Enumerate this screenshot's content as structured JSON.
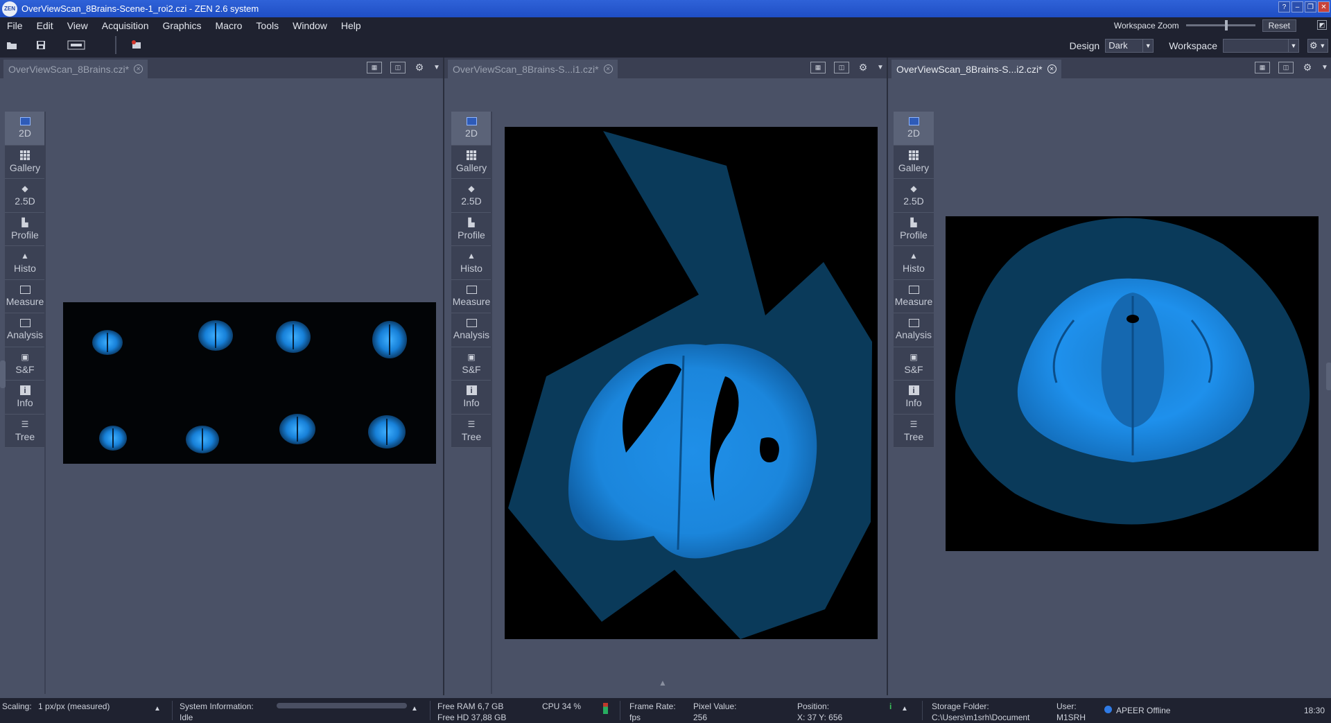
{
  "window": {
    "app_icon": "ZEN",
    "title": "OverViewScan_8Brains-Scene-1_roi2.czi - ZEN 2.6 system",
    "controls": [
      "?",
      "–",
      "❐",
      "✕"
    ]
  },
  "menu": {
    "items": [
      "File",
      "Edit",
      "View",
      "Acquisition",
      "Graphics",
      "Macro",
      "Tools",
      "Window",
      "Help"
    ],
    "workspace_zoom_label": "Workspace Zoom",
    "reset_label": "Reset"
  },
  "toolbar": {
    "design_label": "Design",
    "design_value": "Dark",
    "workspace_label": "Workspace",
    "workspace_value": ""
  },
  "viewbar": {
    "buttons": [
      "2D",
      "Gallery",
      "2.5D",
      "Profile",
      "Histo",
      "Measure",
      "Analysis",
      "S&F",
      "Info",
      "Tree"
    ]
  },
  "panes": [
    {
      "tab_title": "OverViewScan_8Brains.czi*",
      "active": false
    },
    {
      "tab_title": "OverViewScan_8Brains-S...i1.czi*",
      "active": false
    },
    {
      "tab_title": "OverViewScan_8Brains-S...i2.czi*",
      "active": true
    }
  ],
  "status": {
    "scaling_label": "Scaling:",
    "scaling_value": "1 px/px (measured)",
    "sysinfo_label": "System Information:",
    "sysinfo_value": "Idle",
    "free_ram": "Free RAM 6,7 GB",
    "free_hd": "Free HD   37,88 GB",
    "cpu": "CPU 34 %",
    "frame_rate_label": "Frame Rate:",
    "frame_rate_value": "fps",
    "pixel_value_label": "Pixel Value:",
    "pixel_value": "256",
    "position_label": "Position:",
    "position_value": "X: 37    Y: 656",
    "storage_label": "Storage Folder:",
    "storage_value": "C:\\Users\\m1srh\\Document",
    "user_label": "User:",
    "user_value": "M1SRH",
    "apeer": "APEER Offline",
    "time": "18:30"
  },
  "colors": {
    "titlebar": "#2456d0",
    "chrome": "#1f2230",
    "workspace": "#4a5166",
    "fluorescence": "#1e9cff"
  }
}
